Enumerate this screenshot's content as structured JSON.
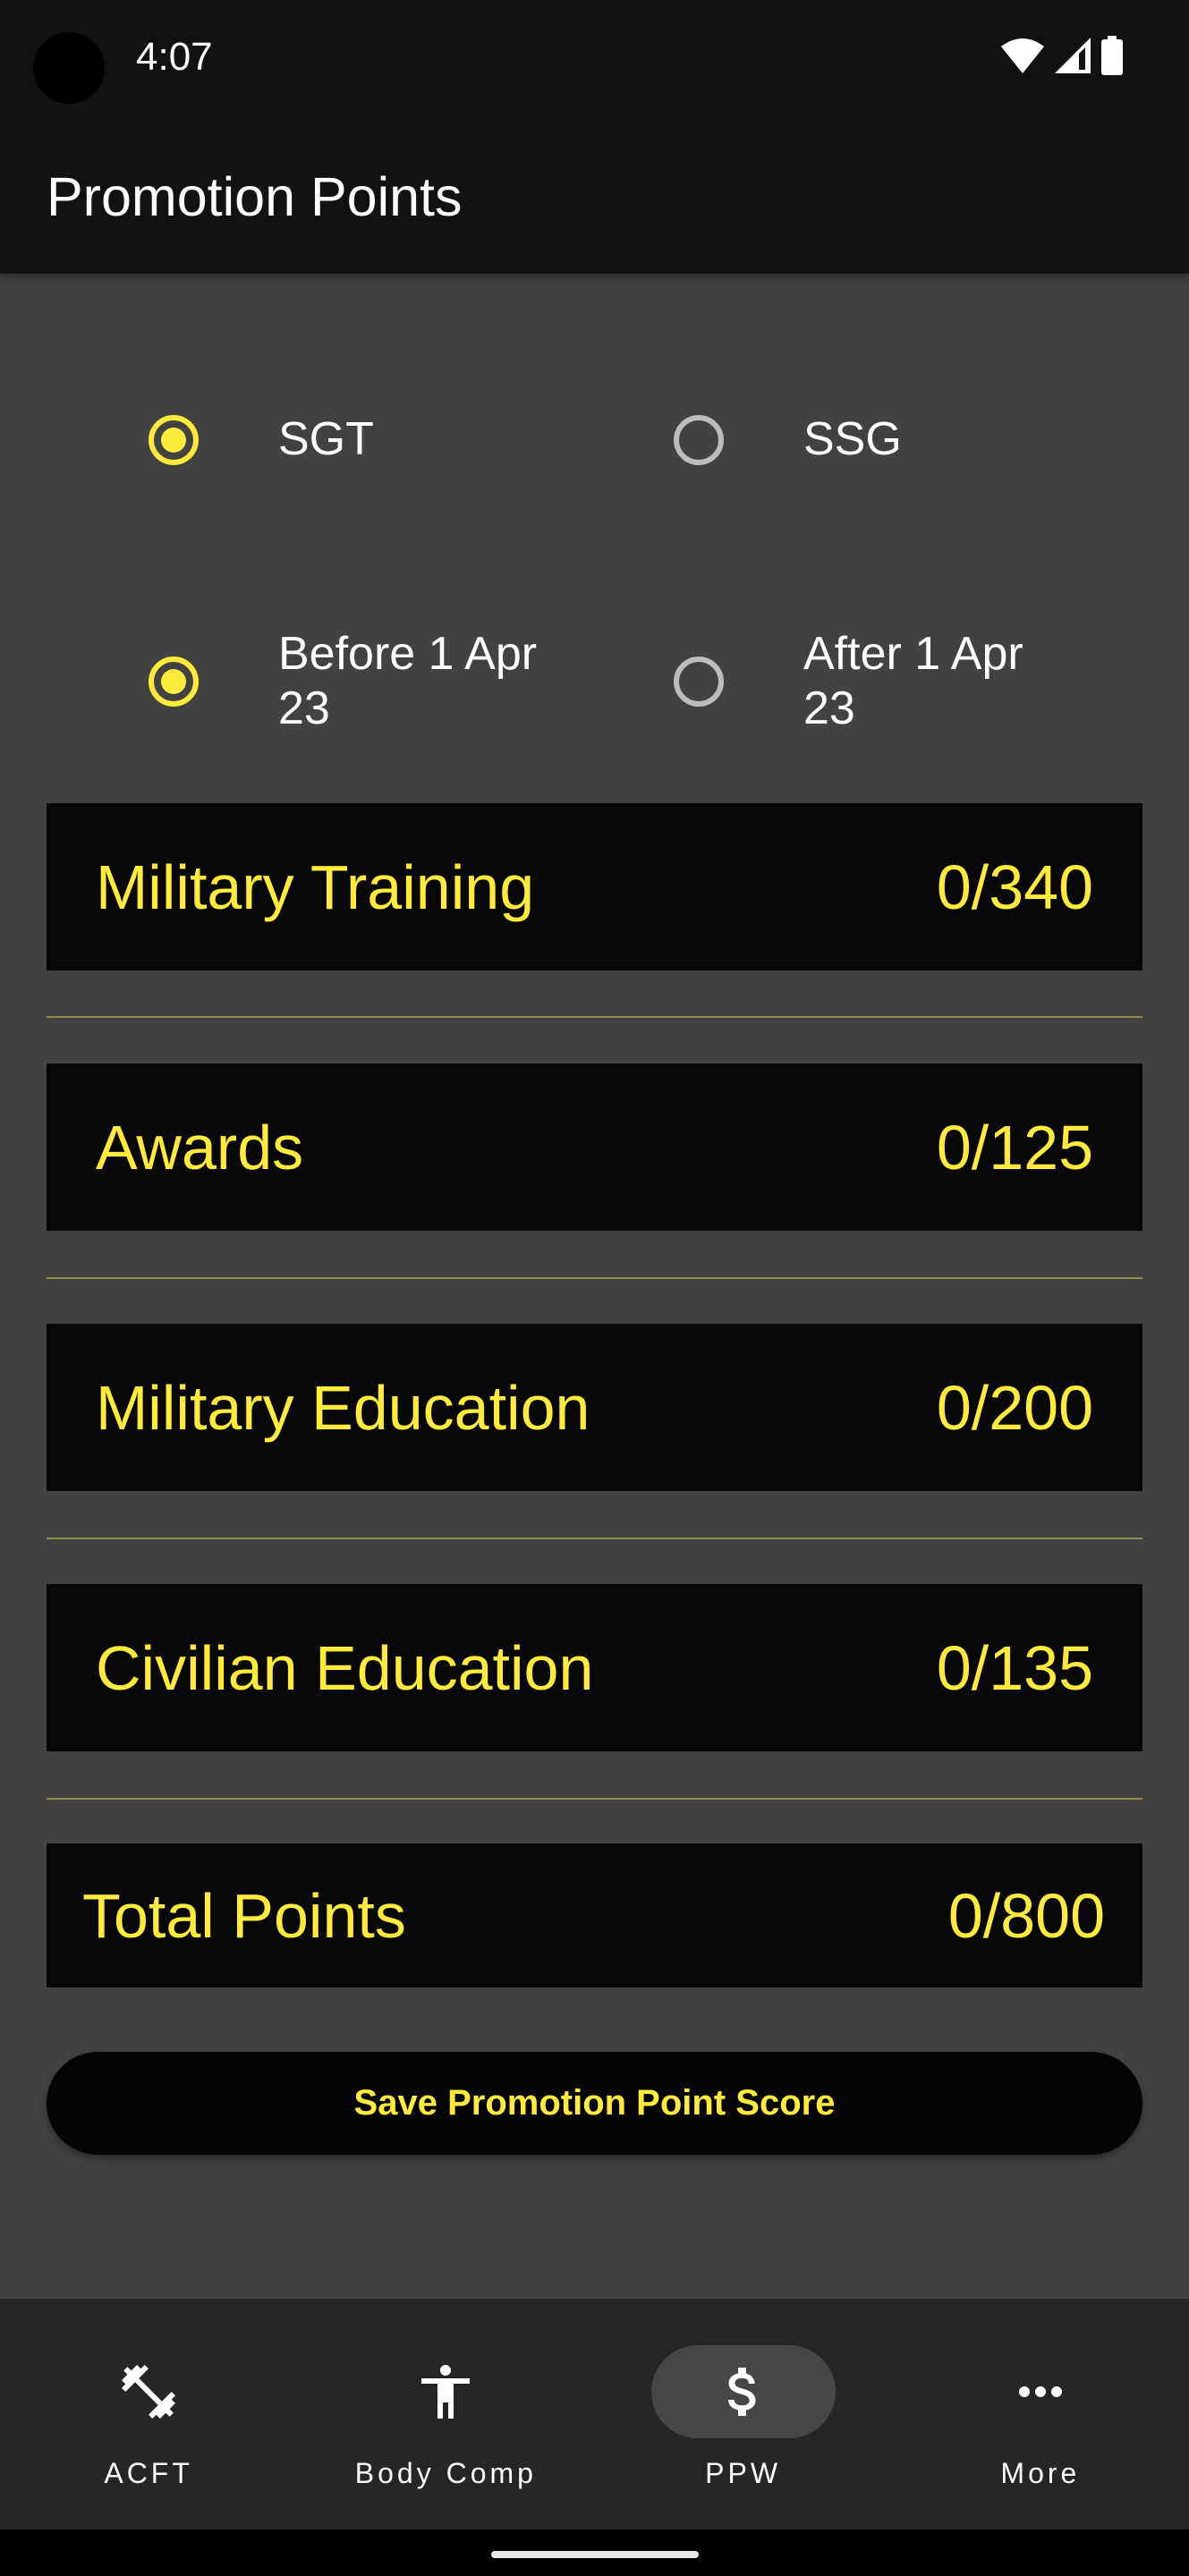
{
  "status_bar": {
    "time": "4:07",
    "icons": [
      "wifi-icon",
      "cell-signal-icon",
      "battery-icon"
    ]
  },
  "app_bar": {
    "title": "Promotion Points"
  },
  "rank_options": [
    {
      "label": "SGT",
      "checked": true
    },
    {
      "label": "SSG",
      "checked": false
    }
  ],
  "date_options": [
    {
      "label": "Before 1 Apr 23",
      "checked": true
    },
    {
      "label": "After 1 Apr 23",
      "checked": false
    }
  ],
  "categories": [
    {
      "label": "Military Training",
      "value": "0/340"
    },
    {
      "label": "Awards",
      "value": "0/125"
    },
    {
      "label": "Military Education",
      "value": "0/200"
    },
    {
      "label": "Civilian Education",
      "value": "0/135"
    }
  ],
  "total": {
    "label": "Total Points",
    "value": "0/800"
  },
  "save_button": {
    "label": "Save Promotion Point Score"
  },
  "bottom_nav": {
    "items": [
      {
        "label": "ACFT",
        "icon": "dumbbell-icon",
        "active": false
      },
      {
        "label": "Body Comp",
        "icon": "person-icon",
        "active": false
      },
      {
        "label": "PPW",
        "icon": "dollar-icon",
        "active": true
      },
      {
        "label": "More",
        "icon": "more-horizontal-icon",
        "active": false
      }
    ]
  },
  "colors": {
    "accent": "#ffeb3b",
    "background": "#424242",
    "app_bar": "#121212",
    "card": "#080808",
    "nav_bar": "#262626",
    "active_pill": "#474747"
  }
}
